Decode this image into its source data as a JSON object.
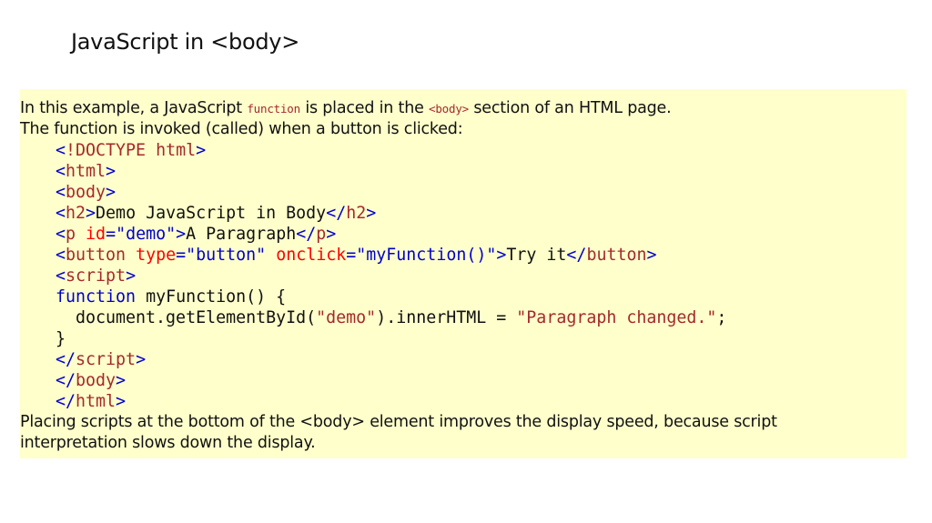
{
  "title": "JavaScript in <body>",
  "intro": {
    "line1_before": "In this example, a JavaScript ",
    "line1_code": "function",
    "line1_middle": " is placed in the ",
    "line1_code2": "<body>",
    "line1_after": " section of an HTML page.",
    "line2": "The function is invoked (called) when a button is clicked:"
  },
  "code": {
    "doctype": "!DOCTYPE html",
    "html": "html",
    "body": "body",
    "h2": "h2",
    "h2_text": "Demo JavaScript in Body",
    "p": "p",
    "p_attr": "id",
    "p_val": "\"demo\"",
    "p_text": "A Paragraph",
    "button": "button",
    "btn_attr1": "type",
    "btn_val1": "\"button\"",
    "btn_attr2": "onclick",
    "btn_val2": "\"myFunction()\"",
    "btn_text": "Try it",
    "script": "script",
    "fn_kw": "function",
    "fn_sig": " myFunction() {",
    "stmt_a": "document.getElementById(",
    "stmt_str1": "\"demo\"",
    "stmt_b": ").innerHTML = ",
    "stmt_str2": "\"Paragraph changed.\"",
    "stmt_c": ";",
    "close_brace": "}"
  },
  "outro": {
    "line1": "Placing scripts at the bottom of the <body> element improves the display speed, because script",
    "line2": "interpretation slows down the display."
  },
  "colors": {
    "panel_background": "#ffffcc",
    "tag_name": "#a52a2a",
    "angle_bracket": "#0000cd",
    "attribute": "#ff0000",
    "attribute_value": "#0000cd",
    "keyword": "#0000cd",
    "string": "#a52a2a"
  }
}
